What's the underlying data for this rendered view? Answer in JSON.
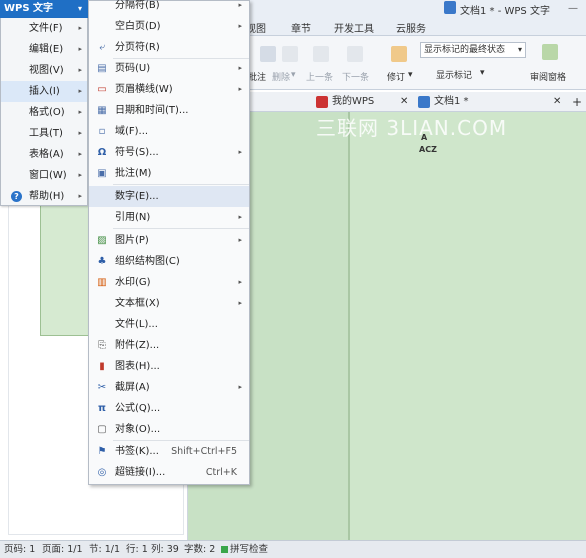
{
  "window": {
    "title": "文档1 * - WPS 文字",
    "minimize_glyph": "—"
  },
  "app_button": {
    "label": "WPS 文字",
    "caret": "▾"
  },
  "main_menu": {
    "items": [
      {
        "label": "文件(F)"
      },
      {
        "label": "编辑(E)"
      },
      {
        "label": "视图(V)"
      },
      {
        "label": "插入(I)"
      },
      {
        "label": "格式(O)"
      },
      {
        "label": "工具(T)"
      },
      {
        "label": "表格(A)"
      },
      {
        "label": "窗口(W)"
      },
      {
        "label": "帮助(H)"
      }
    ],
    "help_icon_glyph": "?",
    "submenu_glyph": "▸"
  },
  "insert_menu": {
    "items": [
      {
        "label": "分隔符(B)",
        "icon": "separator-icon",
        "icon_glyph": "",
        "submenu": true
      },
      {
        "label": "空白页(D)",
        "icon": "blank-page-icon",
        "icon_glyph": "",
        "submenu": true
      },
      {
        "label": "分页符(R)",
        "icon": "page-break-icon",
        "icon_glyph": "⤶",
        "submenu": false
      },
      {
        "label": "页码(U)",
        "icon": "page-number-icon",
        "icon_glyph": "▤",
        "submenu": true
      },
      {
        "label": "页眉横线(W)",
        "icon": "header-line-icon",
        "icon_glyph": "▭",
        "submenu": true
      },
      {
        "label": "日期和时间(T)...",
        "icon": "date-time-icon",
        "icon_glyph": "▦",
        "submenu": false
      },
      {
        "label": "域(F)...",
        "icon": "field-icon",
        "icon_glyph": "▫",
        "submenu": false
      },
      {
        "label": "符号(S)...",
        "icon": "symbol-icon",
        "icon_glyph": "Ω",
        "submenu": true
      },
      {
        "label": "批注(M)",
        "icon": "comment-icon",
        "icon_glyph": "▣",
        "submenu": false
      },
      {
        "label": "数字(E)...",
        "icon": "number-icon",
        "icon_glyph": "",
        "submenu": false
      },
      {
        "label": "引用(N)",
        "icon": "reference-icon",
        "icon_glyph": "",
        "submenu": true
      },
      {
        "label": "图片(P)",
        "icon": "picture-icon",
        "icon_glyph": "▨",
        "submenu": true
      },
      {
        "label": "组织结构图(C)",
        "icon": "org-chart-icon",
        "icon_glyph": "♣",
        "submenu": false
      },
      {
        "label": "水印(G)",
        "icon": "watermark-icon",
        "icon_glyph": "▥",
        "submenu": true
      },
      {
        "label": "文本框(X)",
        "icon": "textbox-icon",
        "icon_glyph": "",
        "submenu": true
      },
      {
        "label": "文件(L)...",
        "icon": "file-icon",
        "icon_glyph": "",
        "submenu": false
      },
      {
        "label": "附件(Z)...",
        "icon": "attachment-icon",
        "icon_glyph": "⎘",
        "submenu": false
      },
      {
        "label": "图表(H)...",
        "icon": "chart-icon",
        "icon_glyph": "▮",
        "submenu": false
      },
      {
        "label": "截屏(A)",
        "icon": "screenshot-icon",
        "icon_glyph": "✂",
        "submenu": true
      },
      {
        "label": "公式(Q)...",
        "icon": "formula-icon",
        "icon_glyph": "π",
        "submenu": false
      },
      {
        "label": "对象(O)...",
        "icon": "object-icon",
        "icon_glyph": "▢",
        "submenu": false
      },
      {
        "label": "书签(K)...",
        "icon": "bookmark-icon",
        "icon_glyph": "⚑",
        "submenu": false,
        "shortcut": "Shift+Ctrl+F5"
      },
      {
        "label": "超链接(I)...",
        "icon": "hyperlink-icon",
        "icon_glyph": "◎",
        "submenu": false,
        "shortcut": "Ctrl+K"
      }
    ]
  },
  "ribbon": {
    "tabs": [
      "视图",
      "章节",
      "开发工具",
      "云服务"
    ],
    "buttons": {
      "comment": "批注",
      "delete": "删除",
      "prev": "上一条",
      "next": "下一条",
      "revise": "修订",
      "show_markup": "显示标记",
      "review_pane": "审阅窗格",
      "dropdown_caret": "▾"
    },
    "markup_select": "显示标记的最终状态"
  },
  "doc_tabs": {
    "add_glyph": "+",
    "close_glyph": "✕",
    "tabs": [
      {
        "label": "我的WPS"
      },
      {
        "label": "文档1 *"
      }
    ]
  },
  "document": {
    "watermark": "三联网 3LIAN.COM",
    "line1": "A",
    "line2": "ACZ"
  },
  "status_bar": {
    "page_num": "页码: 1",
    "pages": "页面: 1/1",
    "section": "节: 1/1",
    "row": "行: 1",
    "col": "列: 39",
    "chars": "字数: 2",
    "spell": "拼写检查"
  },
  "colors": {
    "accent": "#1f6fc5",
    "doc_background": "#c8e1c5",
    "menu_hover": "#dfe7f3"
  }
}
